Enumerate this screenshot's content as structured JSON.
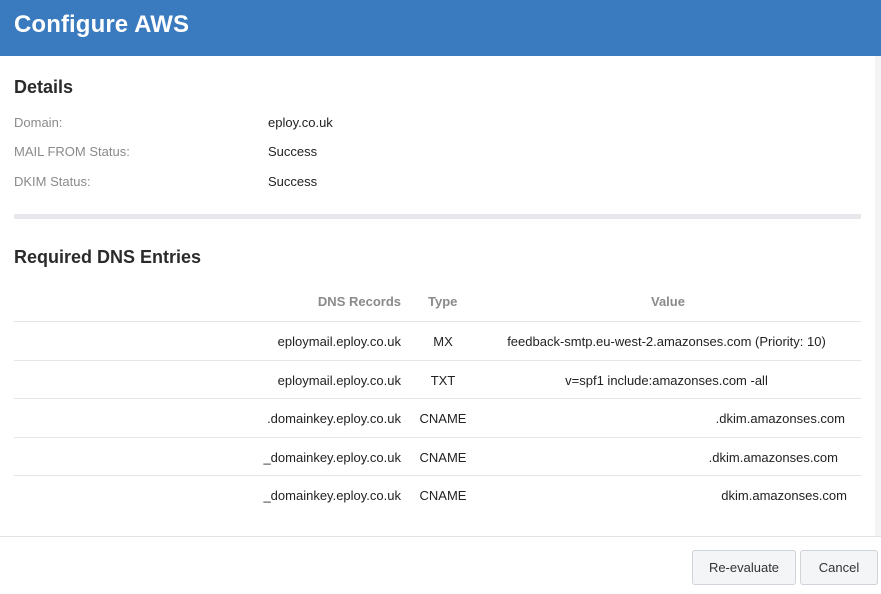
{
  "header": {
    "title": "Configure AWS"
  },
  "details": {
    "title": "Details",
    "rows": [
      {
        "label": "Domain:",
        "value": "eploy.co.uk"
      },
      {
        "label": "MAIL FROM Status:",
        "value": "Success"
      },
      {
        "label": "DKIM Status:",
        "value": "Success"
      }
    ]
  },
  "dns": {
    "title": "Required DNS Entries",
    "columns": {
      "records": "DNS Records",
      "type": "Type",
      "value": "Value"
    },
    "rows": [
      {
        "record": "eploymail.eploy.co.uk",
        "type": "MX",
        "value": "feedback-smtp.eu-west-2.amazonses.com (Priority: 10)"
      },
      {
        "record": "eploymail.eploy.co.uk",
        "type": "TXT",
        "value": "v=spf1 include:amazonses.com -all"
      },
      {
        "record": ".domainkey.eploy.co.uk",
        "type": "CNAME",
        "value": ".dkim.amazonses.com"
      },
      {
        "record": "_domainkey.eploy.co.uk",
        "type": "CNAME",
        "value": ".dkim.amazonses.com"
      },
      {
        "record": "_domainkey.eploy.co.uk",
        "type": "CNAME",
        "value": "dkim.amazonses.com"
      }
    ]
  },
  "footer": {
    "reevaluate_label": "Re-evaluate",
    "cancel_label": "Cancel"
  },
  "colors": {
    "header_bg": "#3a7bbf",
    "header_text": "#ffffff",
    "label_gray": "#8a8a8a"
  }
}
